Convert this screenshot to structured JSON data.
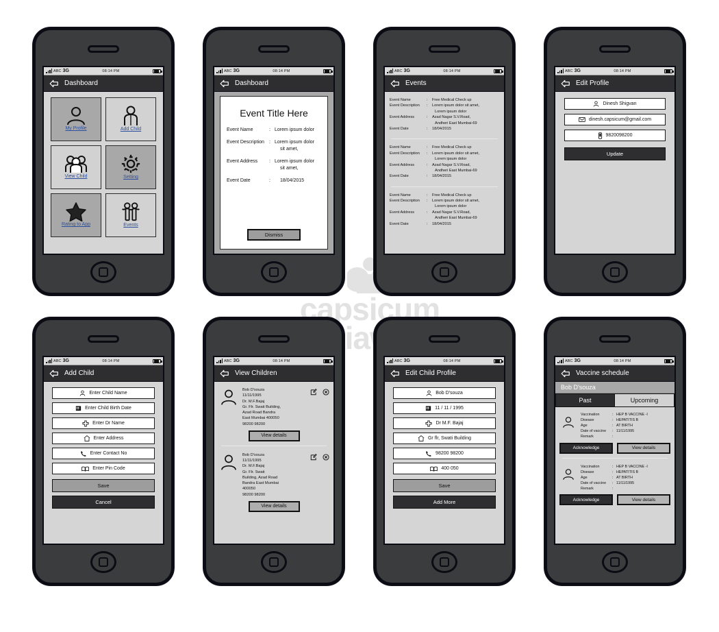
{
  "watermark": {
    "text_line1": "capsicum",
    "text_line2": "mediaworks",
    "registered": "®"
  },
  "status_bar": {
    "carrier": "ABC",
    "network": "3G",
    "time": "08:14 PM",
    "signal_icon": "signal-bars-icon",
    "battery_icon": "battery-icon"
  },
  "screens": [
    {
      "id": "dashboard",
      "nav": {
        "title": "Dashboard",
        "back_icon": "back-arrow-icon"
      },
      "tiles": [
        {
          "label": "My Profile",
          "icon": "user-profile-icon",
          "shade": "dark"
        },
        {
          "label": "Add Child",
          "icon": "add-child-icon",
          "shade": "light"
        },
        {
          "label": "View Child",
          "icon": "group-people-icon",
          "shade": "light"
        },
        {
          "label": "Setting",
          "icon": "gear-icon",
          "shade": "dark"
        },
        {
          "label": "Rating to App",
          "icon": "star-icon",
          "shade": "dark"
        },
        {
          "label": "Events",
          "icon": "people-event-icon",
          "shade": "light"
        }
      ]
    },
    {
      "id": "event-dialog",
      "nav": {
        "title": "Dashboard",
        "back_icon": "back-arrow-icon"
      },
      "dialog": {
        "title": "Event Title Here",
        "rows": [
          {
            "label": "Event Name",
            "colon": ":",
            "value": "Lorem ipsum dolor",
            "value2": ""
          },
          {
            "label": "Event Description",
            "colon": ":",
            "value": "Lorem ipsum dolor",
            "value2": "sit amet,"
          },
          {
            "label": "Event Address",
            "colon": ":",
            "value": "Lorem ipsum dolor",
            "value2": "sit amet,"
          },
          {
            "label": "Event Date",
            "colon": ":",
            "value": "18/04/2015",
            "value2": ""
          }
        ],
        "dismiss_label": "Dismiss"
      }
    },
    {
      "id": "events",
      "nav": {
        "title": "Events",
        "back_icon": "back-arrow-icon"
      },
      "events": [
        {
          "rows": [
            {
              "label": "Event Name",
              "colon": ":",
              "value": "Free Medical Check up",
              "value2": ""
            },
            {
              "label": "Event Description",
              "colon": ":",
              "value": "Lorem ipsum dolor sit amet,",
              "value2": "Lorem ipsum dolor"
            },
            {
              "label": "Event Address",
              "colon": ":",
              "value": "Azad Nagar S.V.Road,",
              "value2": "Andheri East Mumbai-69"
            },
            {
              "label": "Event Date",
              "colon": ":",
              "value": "18/04/2015",
              "value2": ""
            }
          ]
        },
        {
          "rows": [
            {
              "label": "Event Name",
              "colon": ":",
              "value": "Free Medical Check up",
              "value2": ""
            },
            {
              "label": "Event Description",
              "colon": ":",
              "value": "Lorem ipsum dolor sit amet,",
              "value2": "Lorem ipsum dolor"
            },
            {
              "label": "Event Address",
              "colon": ":",
              "value": "Azad Nagar S.V.Road,",
              "value2": "Andheri East Mumbai-69"
            },
            {
              "label": "Event Date",
              "colon": ":",
              "value": "18/04/2015",
              "value2": ""
            }
          ]
        },
        {
          "rows": [
            {
              "label": "Event Name",
              "colon": ":",
              "value": "Free Medical Check up",
              "value2": ""
            },
            {
              "label": "Event Description",
              "colon": ":",
              "value": "Lorem ipsum dolor sit amet,",
              "value2": "Lorem ipsum dolor"
            },
            {
              "label": "Event Address",
              "colon": ":",
              "value": "Azad Nagar S.V.Road,",
              "value2": "Andheri East Mumbai-69"
            },
            {
              "label": "Event Date",
              "colon": ":",
              "value": "18/04/2015",
              "value2": ""
            }
          ]
        }
      ]
    },
    {
      "id": "edit-profile",
      "nav": {
        "title": "Edit Profile",
        "back_icon": "back-arrow-icon"
      },
      "fields": [
        {
          "value": "Dinesh Shigvan",
          "icon": "user-icon"
        },
        {
          "value": "dinesh.capsicum@gmail.com",
          "icon": "mail-icon"
        },
        {
          "value": "9820098200",
          "icon": "phone-icon"
        }
      ],
      "update_label": "Update"
    },
    {
      "id": "add-child",
      "nav": {
        "title": "Add Child",
        "back_icon": "back-arrow-icon"
      },
      "fields": [
        {
          "placeholder": "Enter Child Name",
          "icon": "user-icon"
        },
        {
          "placeholder": "Enter Child Birth Date",
          "icon": "calendar-icon"
        },
        {
          "placeholder": "Enter Dr Name",
          "icon": "medical-cross-icon"
        },
        {
          "placeholder": "Enter Address",
          "icon": "home-icon"
        },
        {
          "placeholder": "Enter Contact No",
          "icon": "phone-icon"
        },
        {
          "placeholder": "Enter Pin Code",
          "icon": "book-icon"
        }
      ],
      "save_label": "Save",
      "cancel_label": "Cancel"
    },
    {
      "id": "view-children",
      "nav": {
        "title": "View Children",
        "back_icon": "back-arrow-icon"
      },
      "children": [
        {
          "name": "Bob D'souza",
          "dob": "11/11/1995",
          "doctor": "Dr. M.F.Bajaj",
          "address_lines": [
            "Gr. Flr. Swati Building,",
            "Azad Road Bandra",
            "East Mumbai 400050"
          ],
          "phone": "98200 98200",
          "edit_icon": "edit-icon",
          "delete_icon": "delete-circle-icon",
          "view_details_label": "View details"
        },
        {
          "name": "Bob D'souza",
          "dob": "11/11/1995",
          "doctor": "Dr. M.F.Bajaj",
          "address_lines": [
            "Gr. Flr. Swati",
            "Building, Azad Road",
            "Bandra East Mumbai",
            "400050"
          ],
          "phone": "98200 98200",
          "edit_icon": "edit-icon",
          "delete_icon": "delete-circle-icon",
          "view_details_label": "View details"
        }
      ]
    },
    {
      "id": "edit-child-profile",
      "nav": {
        "title": "Edit Child Profile",
        "back_icon": "back-arrow-icon"
      },
      "fields": [
        {
          "value": "Bob D'souza",
          "icon": "user-icon"
        },
        {
          "value": "11 / 11 / 1995",
          "icon": "calendar-icon"
        },
        {
          "value": "Dr M.F. Bajaj",
          "icon": "medical-cross-icon"
        },
        {
          "value": "Gr flr, Swati Building",
          "icon": "home-icon"
        },
        {
          "value": "98200 98200",
          "icon": "phone-icon"
        },
        {
          "value": "400 050",
          "icon": "book-icon"
        }
      ],
      "save_label": "Save",
      "add_more_label": "Add More"
    },
    {
      "id": "vaccine-schedule",
      "nav": {
        "title": "Vaccine schedule",
        "back_icon": "back-arrow-icon"
      },
      "child_name": "Bob D'souza",
      "tabs": [
        {
          "label": "Past",
          "active": true
        },
        {
          "label": "Upcoming",
          "active": false
        }
      ],
      "entries": [
        {
          "rows": [
            {
              "label": "Vaccination",
              "colon": ":",
              "value": "HEP B VACCINE -I"
            },
            {
              "label": "Disease",
              "colon": ":",
              "value": "HEPATITIS B"
            },
            {
              "label": "Age",
              "colon": ":",
              "value": "AT BIRTH"
            },
            {
              "label": "Date of vaccine",
              "colon": ":",
              "value": "11/11/1995"
            },
            {
              "label": "Remark",
              "colon": ":",
              "value": ""
            }
          ],
          "acknowledge_label": "Acknowledge",
          "view_details_label": "View details"
        },
        {
          "rows": [
            {
              "label": "Vaccination",
              "colon": ":",
              "value": "HEP B VACCINE -I"
            },
            {
              "label": "Disease",
              "colon": ":",
              "value": "HEPATITIS B"
            },
            {
              "label": "Age",
              "colon": ":",
              "value": "AT BIRTH"
            },
            {
              "label": "Date of vaccine",
              "colon": ":",
              "value": "11/11/1995"
            },
            {
              "label": "Remark",
              "colon": ":",
              "value": ""
            }
          ],
          "acknowledge_label": "Acknowledge",
          "view_details_label": "View details"
        }
      ]
    }
  ]
}
